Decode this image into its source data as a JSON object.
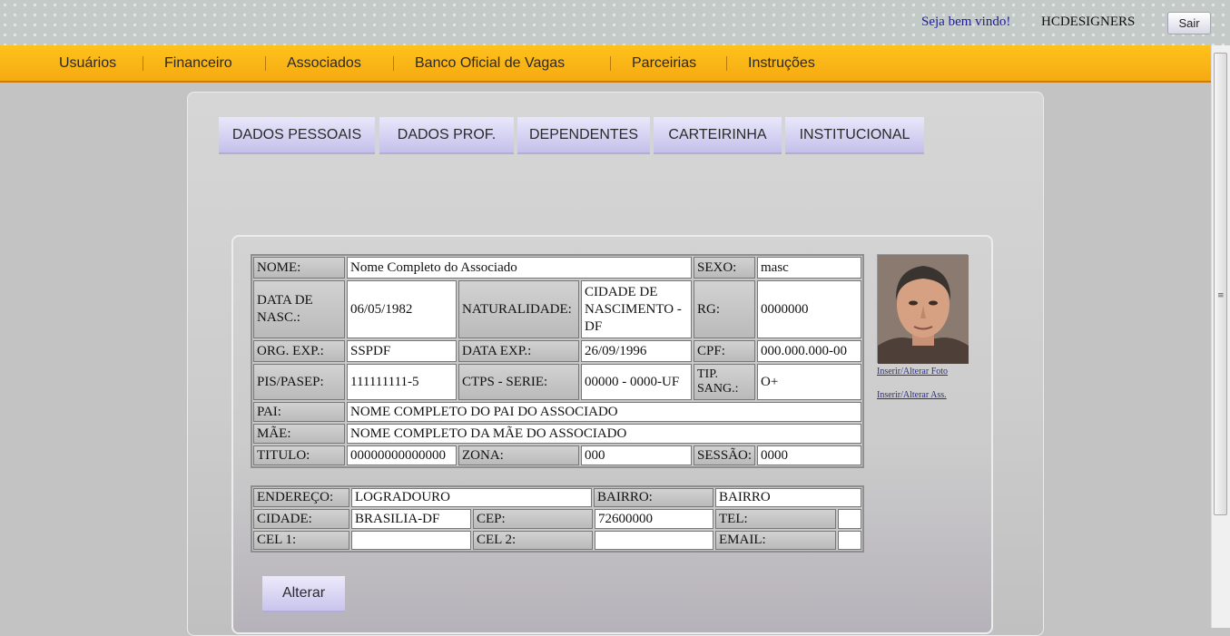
{
  "header": {
    "welcome": "Seja bem vindo!",
    "username": "HCDESIGNERS",
    "logout_label": "Sair"
  },
  "menu": {
    "items": [
      "Usuários",
      "Financeiro",
      "Associados",
      "Banco Oficial de Vagas",
      "Parceirias",
      "Instruções"
    ]
  },
  "tabs": [
    "DADOS PESSOAIS",
    "DADOS PROF.",
    "DEPENDENTES",
    "CARTEIRINHA",
    "INSTITUCIONAL"
  ],
  "personal": {
    "labels": {
      "nome": "NOME:",
      "sexo": "SEXO:",
      "data_nasc": "DATA DE NASC.:",
      "naturalidade": "NATURALIDADE:",
      "rg": "RG:",
      "org_exp": "ORG. EXP.:",
      "data_exp": "DATA EXP.:",
      "cpf": "CPF:",
      "pis": "PIS/PASEP:",
      "ctps": "CTPS - SERIE:",
      "tip_sang": "TIP. SANG.:",
      "pai": "PAI:",
      "mae": "MÃE:",
      "titulo": "TITULO:",
      "zona": "ZONA:",
      "sessao": "SESSÃO:"
    },
    "values": {
      "nome": "Nome Completo do Associado",
      "sexo": "masc",
      "data_nasc": "06/05/1982",
      "naturalidade": "CIDADE DE NASCIMENTO - DF",
      "rg": "0000000",
      "org_exp": "SSPDF",
      "data_exp": "26/09/1996",
      "cpf": "000.000.000-00",
      "pis": "111111111-5",
      "ctps": "00000 - 0000-UF",
      "tip_sang": "O+",
      "pai": "NOME COMPLETO DO PAI DO ASSOCIADO",
      "mae": "NOME COMPLETO DA MÃE DO ASSOCIADO",
      "titulo": "00000000000000",
      "zona": "000",
      "sessao": "0000"
    }
  },
  "address": {
    "labels": {
      "endereco": "ENDEREÇO:",
      "bairro": "BAIRRO:",
      "cidade": "CIDADE:",
      "cep": "CEP:",
      "tel": "TEL:",
      "cel1": "CEL 1:",
      "cel2": "CEL 2:",
      "email": "EMAIL:"
    },
    "values": {
      "endereco": "LOGRADOURO",
      "bairro": "BAIRRO",
      "cidade": "BRASILIA-DF",
      "cep": "72600000",
      "tel": "",
      "cel1": "",
      "cel2": "",
      "email": ""
    }
  },
  "photo_links": {
    "photo": "Inserir/Alterar Foto",
    "signature": "Inserir/Alterar Ass."
  },
  "actions": {
    "save_label": "Alterar"
  }
}
